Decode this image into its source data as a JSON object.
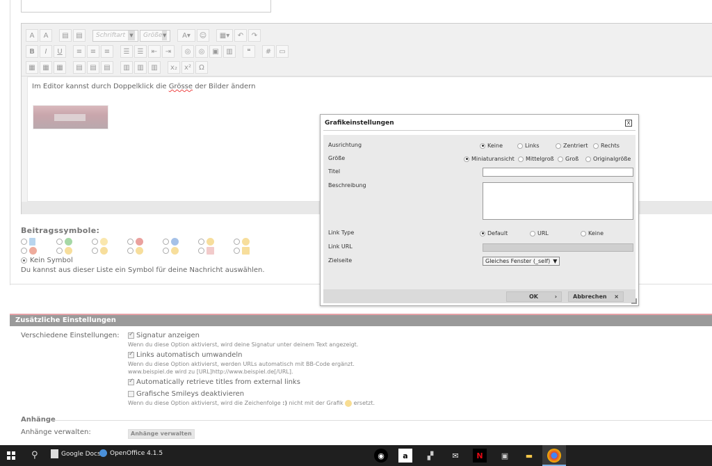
{
  "editor": {
    "font_select": "Schriftart",
    "size_select": "Größe",
    "content_text_before": "Im Editor kannst durch Doppelklick die ",
    "content_text_underlined": "Grösse",
    "content_text_after": "  der Bilder ändern"
  },
  "symbols": {
    "title": "Beitragssymbole:",
    "none_label": "Kein Symbol",
    "hint": "Du kannst aus dieser Liste ein Symbol für deine Nachricht auswählen."
  },
  "extra": {
    "header": "Zusätzliche Einstellungen",
    "label": "Verschiedene Einstellungen:",
    "options": [
      {
        "label": "Signatur anzeigen",
        "desc": "Wenn du diese Option aktivierst, wird deine Signatur unter deinem Text angezeigt.",
        "checked": true
      },
      {
        "label": "Links automatisch umwandeln",
        "desc": "Wenn du diese Option aktivierst, werden URLs automatisch mit BB-Code ergänzt.",
        "desc2": "www.beispiel.de wird zu [URL]http://www.beispiel.de[/URL].",
        "checked": true
      },
      {
        "label": "Automatically retrieve titles from external links",
        "checked": true
      },
      {
        "label": "Grafische Smileys deaktivieren",
        "desc_before": "Wenn du diese Option aktivierst, wird die Zeichenfolge ",
        "desc_code": ":)",
        "desc_mid": " nicht mit der Grafik ",
        "desc_after": " ersetzt.",
        "checked": false
      }
    ]
  },
  "attachments": {
    "title": "Anhänge",
    "label": "Anhänge verwalten:",
    "button": "Anhänge verwalten"
  },
  "dialog": {
    "title": "Grafikeinstellungen",
    "close": "X",
    "ausrichtung_label": "Ausrichtung",
    "ausrichtung_options": [
      "Keine",
      "Links",
      "Zentriert",
      "Rechts"
    ],
    "ausrichtung_selected": "Keine",
    "groesse_label": "Größe",
    "groesse_options": [
      "Miniaturansicht",
      "Mittelgroß",
      "Groß",
      "Originalgröße"
    ],
    "groesse_selected": "Miniaturansicht",
    "titel_label": "Titel",
    "titel_value": "",
    "beschreibung_label": "Beschreibung",
    "beschreibung_value": "",
    "linktype_label": "Link Type",
    "linktype_options": [
      "Default",
      "URL",
      "Keine"
    ],
    "linktype_selected": "Default",
    "linkurl_label": "Link URL",
    "zielseite_label": "Zielseite",
    "zielseite_value": "Gleiches Fenster (_self)",
    "ok_button": "OK",
    "cancel_button": "Abbrechen"
  },
  "taskbar": {
    "apps": [
      "Google Docs",
      "OpenOffice 4.1.5"
    ]
  }
}
